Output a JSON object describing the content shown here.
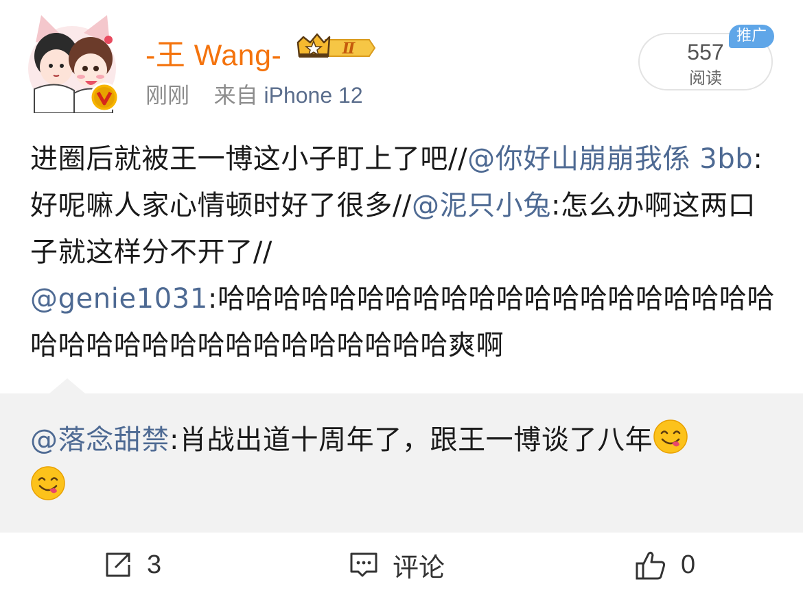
{
  "post": {
    "author_name": "-王 Wang-",
    "member_level": "Ⅱ",
    "time": "刚刚",
    "source_prefix": "来自",
    "source_device": "iPhone 12",
    "reads": {
      "count": "557",
      "label": "阅读",
      "badge": "推广"
    },
    "body": {
      "part1": "进圈后就被王一博这小子盯上了吧",
      "sep1": "//",
      "mention1": "@你好山崩崩我係 3bb",
      "part2": ":好呢嘛人家心情顿时好了很多",
      "sep2": "//",
      "mention2": "@泥只小兔",
      "part3": ":怎么办啊这两口子就这样分不开了",
      "sep3": "//",
      "mention3": "@genie1031",
      "part4": ":哈哈哈哈哈哈哈哈哈哈哈哈哈哈哈哈哈哈哈哈哈哈哈哈哈哈哈哈哈哈哈哈哈哈哈爽啊"
    }
  },
  "quote": {
    "mention": "@落念甜禁",
    "text": ":肖战出道十周年了，跟王一博谈了八年",
    "emoji": "yum-face-emoji"
  },
  "actions": {
    "repost_count": "3",
    "comment_label": "评论",
    "like_count": "0"
  },
  "colors": {
    "author": "#f4730d",
    "mention": "#4e6a93",
    "badge": "#5fa6e8",
    "quote_bg": "#f2f2f2"
  }
}
